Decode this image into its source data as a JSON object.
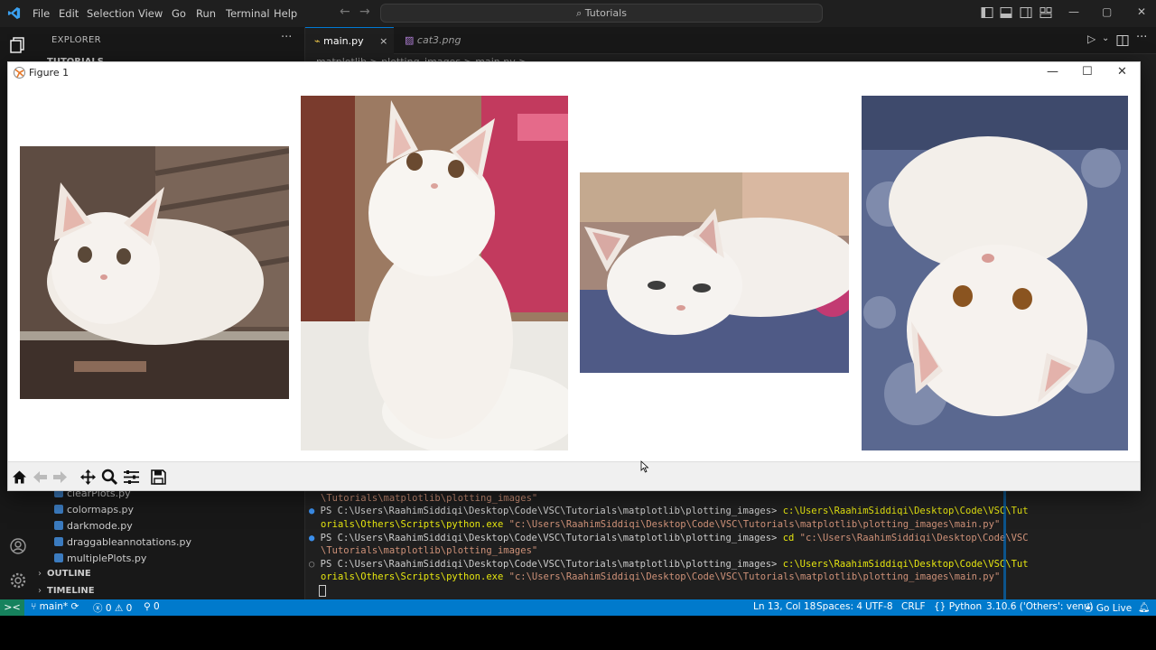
{
  "vscode": {
    "menu": [
      "File",
      "Edit",
      "Selection",
      "View",
      "Go",
      "Run",
      "Terminal",
      "Help"
    ],
    "command_center": "Tutorials",
    "explorer_title": "EXPLORER",
    "explorer_more": "···",
    "folder_name": "TUTORIALS",
    "files": [
      "clearPlots.py",
      "colormaps.py",
      "darkmode.py",
      "draggableannotations.py",
      "multiplePlots.py"
    ],
    "sections": [
      "OUTLINE",
      "TIMELINE"
    ],
    "tabs": [
      {
        "label": "main.py",
        "active": true,
        "close": "×"
      },
      {
        "label": "cat3.png",
        "active": false
      }
    ],
    "breadcrumb": "matplotlib > plotting_images > main.py > ..."
  },
  "terminal": {
    "lines": [
      {
        "prompt": "",
        "text": "\\Tutorials\\matplotlib\\plotting_images\""
      },
      {
        "prompt": "PS C:\\Users\\RaahimSiddiqi\\Desktop\\Code\\VSC\\Tutorials\\matplotlib\\plotting_images> ",
        "cmd": "c:\\Users\\RaahimSiddiqi\\Desktop\\Code\\VSC\\Tut"
      },
      {
        "prompt": "",
        "cmd": "orials\\Others\\Scripts\\python.exe",
        "arg": " \"c:\\Users\\RaahimSiddiqi\\Desktop\\Code\\VSC\\Tutorials\\matplotlib\\plotting_images\\main.py\""
      },
      {
        "prompt": "PS C:\\Users\\RaahimSiddiqi\\Desktop\\Code\\VSC\\Tutorials\\matplotlib\\plotting_images> ",
        "cmd": "cd",
        "arg": " \"c:\\Users\\RaahimSiddiqi\\Desktop\\Code\\VSC"
      },
      {
        "prompt": "",
        "arg": "\\Tutorials\\matplotlib\\plotting_images\""
      },
      {
        "prompt": "PS C:\\Users\\RaahimSiddiqi\\Desktop\\Code\\VSC\\Tutorials\\matplotlib\\plotting_images> ",
        "cmd": "c:\\Users\\RaahimSiddiqi\\Desktop\\Code\\VSC\\Tut"
      },
      {
        "prompt": "",
        "cmd": "orials\\Others\\Scripts\\python.exe",
        "arg": " \"c:\\Users\\RaahimSiddiqi\\Desktop\\Code\\VSC\\Tutorials\\matplotlib\\plotting_images\\main.py\""
      }
    ]
  },
  "statusbar": {
    "remote_icon": "><",
    "branch": "main*",
    "errors": "0",
    "warnings": "0",
    "ports": "0",
    "cursor_pos": "Ln 13, Col 18",
    "spaces": "Spaces: 4",
    "encoding": "UTF-8",
    "eol": "CRLF",
    "language": "Python",
    "interpreter": "3.10.6 ('Others': venv)",
    "golive": "Go Live"
  },
  "figure": {
    "title": "Figure 1",
    "images": [
      {
        "name": "cat-image-1",
        "description_icon": "cat-photo",
        "bg": "#6b5a4e"
      },
      {
        "name": "cat-image-2",
        "description_icon": "cat-photo",
        "bg": "#8b6a5a"
      },
      {
        "name": "cat-image-3",
        "description_icon": "cat-photo",
        "bg": "#7a6f6a"
      },
      {
        "name": "cat-image-4",
        "description_icon": "cat-photo",
        "bg": "#5a6890"
      }
    ],
    "toolbar_icons": [
      "home-icon",
      "back-icon",
      "forward-icon",
      "pan-icon",
      "zoom-icon",
      "configure-subplots-icon",
      "save-icon"
    ]
  },
  "colors": {
    "vscode_bg": "#1f1f1f",
    "statusbar": "#007acc",
    "remote": "#16825d",
    "accent": "#0078d4"
  }
}
